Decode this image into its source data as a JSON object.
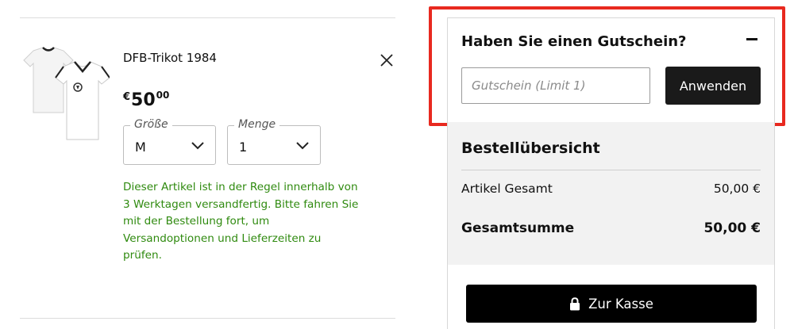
{
  "cart_item": {
    "name": "DFB-Trikot 1984",
    "image_icon": "white-jersey-image",
    "remove_icon": "close-icon",
    "price": {
      "currency": "€",
      "whole": "50",
      "cents": "00"
    },
    "size": {
      "label": "Größe",
      "value": "M"
    },
    "quantity": {
      "label": "Menge",
      "value": "1"
    },
    "shipping_note": "Dieser Artikel ist in der Regel innerhalb von 3 Werktagen versandfertig. Bitte fahren Sie mit der Bestellung fort, um Versandoptionen und Lieferzeiten zu prüfen."
  },
  "coupon": {
    "title": "Haben Sie einen Gutschein?",
    "toggle_icon": "minus-icon",
    "input_value": "",
    "input_placeholder": "Gutschein (Limit 1)",
    "apply_label": "Anwenden"
  },
  "summary": {
    "title": "Bestellübersicht",
    "subtotal_label": "Artikel Gesamt",
    "subtotal_value": "50,00 €",
    "total_label": "Gesamtsumme",
    "total_value": "50,00 €"
  },
  "checkout": {
    "label": "Zur Kasse",
    "icon": "lock-icon"
  },
  "colors": {
    "accent_red": "#e8291f",
    "ship_green": "#2f8a0f",
    "button_dark": "#1a1a1a",
    "summary_bg": "#f2f2f2"
  }
}
